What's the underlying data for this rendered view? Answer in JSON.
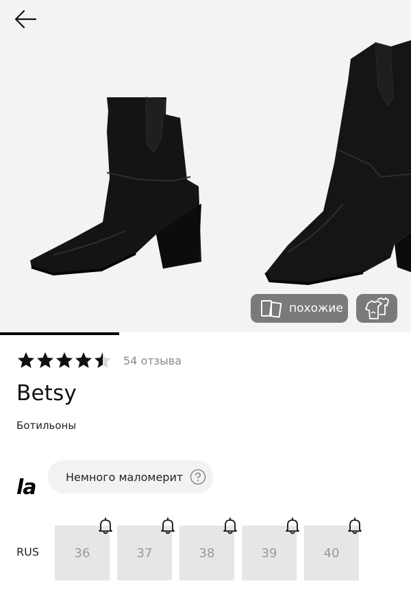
{
  "header": {
    "back_icon": "arrow-left-icon"
  },
  "gallery": {
    "progress_fraction": 0.29,
    "similar_label": "похожие",
    "similar_icon": "cards-icon",
    "outfit_icon": "wardrobe-icon"
  },
  "product": {
    "rating": 4.5,
    "reviews_label": "54 отзыва",
    "name": "Betsy",
    "category": "Ботильоны"
  },
  "fit": {
    "brand_logo": "la",
    "advice": "Немного маломерит",
    "help_icon": "question-circle-icon"
  },
  "sizes": {
    "system_label": "RUS",
    "items": [
      {
        "value": "36",
        "notify_icon": "bell-icon"
      },
      {
        "value": "37",
        "notify_icon": "bell-icon"
      },
      {
        "value": "38",
        "notify_icon": "bell-icon"
      },
      {
        "value": "39",
        "notify_icon": "bell-icon"
      },
      {
        "value": "40",
        "notify_icon": "bell-icon"
      }
    ]
  },
  "colors": {
    "star": "#111111",
    "pill": "#7a7a7a",
    "size_bg": "#e6e6e6",
    "size_text": "#9a9a9a"
  }
}
